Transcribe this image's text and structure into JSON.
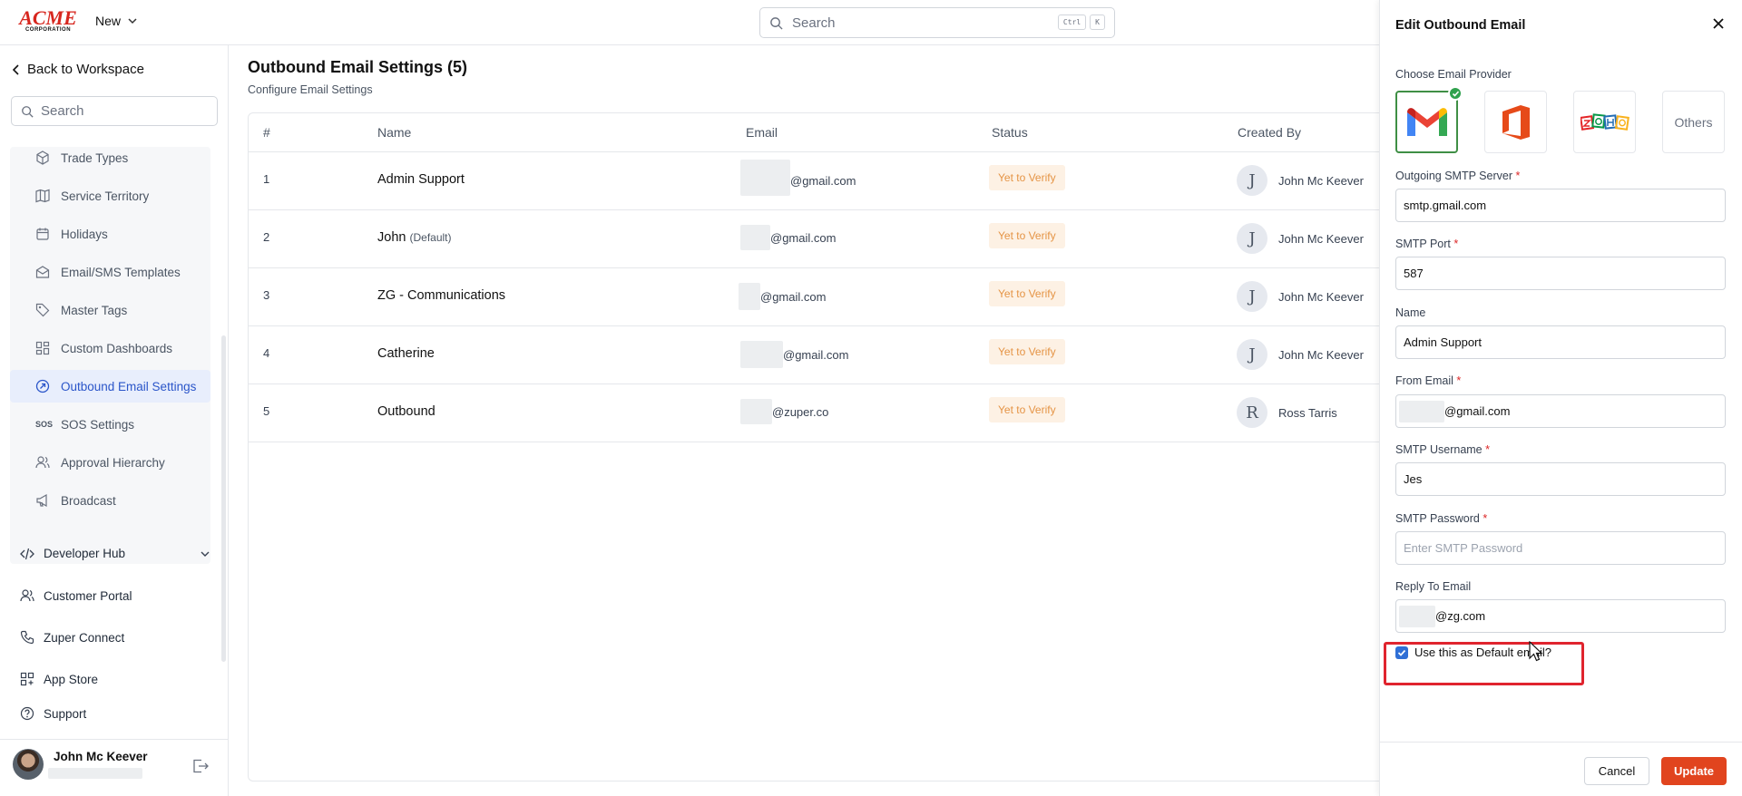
{
  "topbar": {
    "logo_top": "ACME",
    "logo_bottom": "CORPORATION",
    "new_label": "New",
    "search_placeholder": "Search",
    "kbd1": "Ctrl",
    "kbd2": "K"
  },
  "sidebar": {
    "back_label": "Back to Workspace",
    "search_placeholder": "Search",
    "items": [
      {
        "label": "Trade Types",
        "icon": "box-icon"
      },
      {
        "label": "Service Territory",
        "icon": "map-icon"
      },
      {
        "label": "Holidays",
        "icon": "calendar-icon"
      },
      {
        "label": "Email/SMS Templates",
        "icon": "envelope-icon"
      },
      {
        "label": "Master Tags",
        "icon": "tag-icon"
      },
      {
        "label": "Custom Dashboards",
        "icon": "dashboard-icon"
      },
      {
        "label": "Outbound Email Settings",
        "icon": "outbound-icon",
        "active": true
      },
      {
        "label": "SOS Settings",
        "icon": "sos-icon"
      },
      {
        "label": "Approval Hierarchy",
        "icon": "users-icon"
      },
      {
        "label": "Broadcast",
        "icon": "megaphone-icon"
      }
    ],
    "sos_glyph": "SOS",
    "developer_hub": "Developer Hub",
    "customer_portal": "Customer Portal",
    "zuper_connect": "Zuper Connect",
    "app_store": "App Store",
    "support": "Support",
    "user_name": "John Mc Keever"
  },
  "main": {
    "title": "Outbound Email Settings (5)",
    "subtitle": "Configure Email Settings",
    "columns": [
      "#",
      "Name",
      "Email",
      "Status",
      "Created By"
    ],
    "rows": [
      {
        "num": "1",
        "name": "Admin Support",
        "tag": "",
        "email": "@gmail.com",
        "status": "Yet to Verify",
        "initial": "J",
        "creator": "John Mc Keever"
      },
      {
        "num": "2",
        "name": "John",
        "tag": "(Default)",
        "email": "@gmail.com",
        "status": "Yet to Verify",
        "initial": "J",
        "creator": "John Mc Keever"
      },
      {
        "num": "3",
        "name": "ZG - Communications",
        "tag": "",
        "email": "@gmail.com",
        "status": "Yet to Verify",
        "initial": "J",
        "creator": "John Mc Keever"
      },
      {
        "num": "4",
        "name": "Catherine",
        "tag": "",
        "email": "@gmail.com",
        "status": "Yet to Verify",
        "initial": "J",
        "creator": "John Mc Keever"
      },
      {
        "num": "5",
        "name": "Outbound",
        "tag": "",
        "email": "@zuper.co",
        "status": "Yet to Verify",
        "initial": "R",
        "creator": "Ross Tarris"
      }
    ]
  },
  "panel": {
    "title": "Edit Outbound Email",
    "choose_provider": "Choose Email Provider",
    "provider_others": "Others",
    "smtp_server_label": "Outgoing SMTP Server",
    "smtp_server_value": "smtp.gmail.com",
    "smtp_port_label": "SMTP Port",
    "smtp_port_value": "587",
    "name_label": "Name",
    "name_value": "Admin Support",
    "from_email_label": "From Email",
    "from_email_value": "@gmail.com",
    "smtp_username_label": "SMTP Username",
    "smtp_username_value": "Jes",
    "smtp_password_label": "SMTP Password",
    "smtp_password_placeholder": "Enter SMTP Password",
    "reply_to_label": "Reply To Email",
    "reply_to_value": "@zg.com",
    "default_checkbox_label": "Use this as Default email?",
    "required_mark": "*",
    "cancel": "Cancel",
    "update": "Update",
    "colors": {
      "accent": "#e1441e",
      "checkbox": "#2f6fd6",
      "highlight": "#e0242e",
      "active_nav": "#2a55c9"
    }
  }
}
